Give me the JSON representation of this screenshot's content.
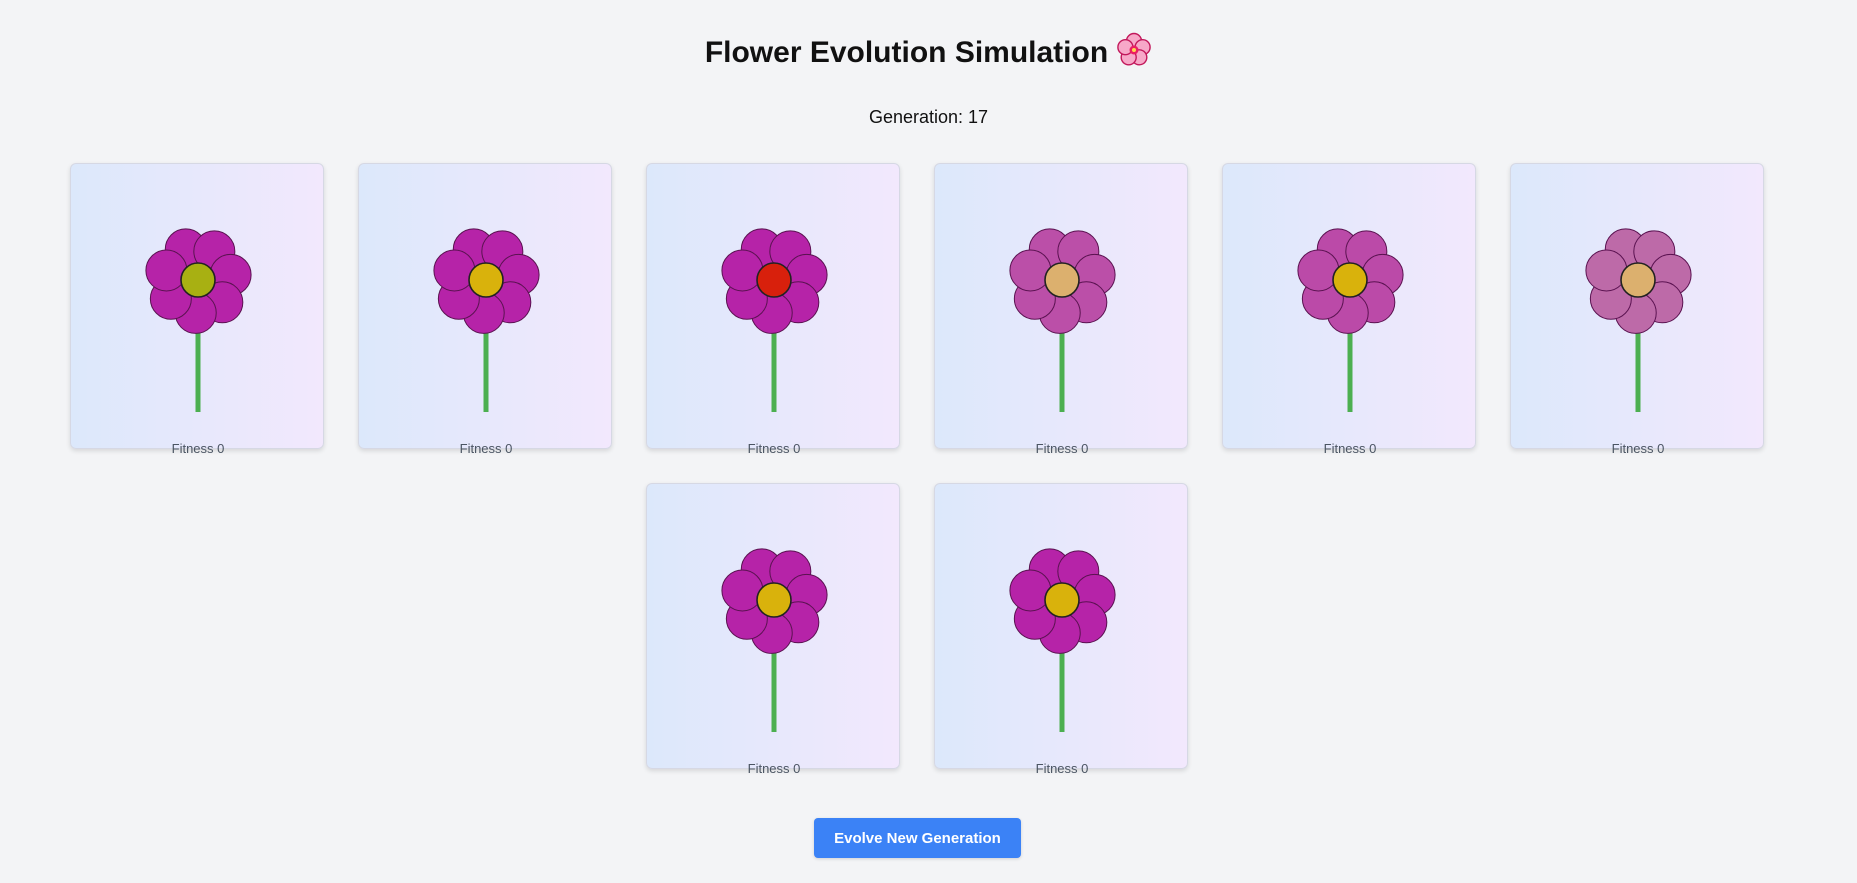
{
  "header": {
    "title": "Flower Evolution Simulation",
    "title_icon": "cherry-blossom-icon",
    "generation_label": "Generation: 17"
  },
  "flowers": [
    {
      "fitness_label": "Fitness 0",
      "petal_color": "#b623a8",
      "center_color": "#a8b012",
      "petal_count": 7
    },
    {
      "fitness_label": "Fitness 0",
      "petal_color": "#b623a8",
      "center_color": "#d9b20c",
      "petal_count": 7
    },
    {
      "fitness_label": "Fitness 0",
      "petal_color": "#b623a8",
      "center_color": "#d8200c",
      "petal_count": 7
    },
    {
      "fitness_label": "Fitness 0",
      "petal_color": "#bb4fa8",
      "center_color": "#dcb06e",
      "petal_count": 7
    },
    {
      "fitness_label": "Fitness 0",
      "petal_color": "#bb4aa8",
      "center_color": "#d9b20c",
      "petal_count": 7
    },
    {
      "fitness_label": "Fitness 0",
      "petal_color": "#bd6aa8",
      "center_color": "#dcb06e",
      "petal_count": 7
    },
    {
      "fitness_label": "Fitness 0",
      "petal_color": "#b623a8",
      "center_color": "#d9b20c",
      "petal_count": 7
    },
    {
      "fitness_label": "Fitness 0",
      "petal_color": "#b623a8",
      "center_color": "#d9b20c",
      "petal_count": 7
    }
  ],
  "colors": {
    "stem": "#4caf50",
    "button_bg": "#3b82f6",
    "page_bg": "#f3f4f6"
  },
  "actions": {
    "evolve_label": "Evolve New Generation"
  }
}
